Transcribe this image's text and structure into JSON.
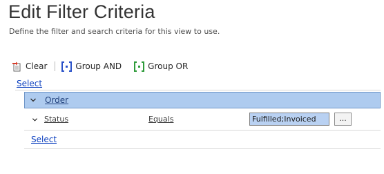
{
  "header": {
    "title": "Edit Filter Criteria",
    "subtitle": "Define the filter and search criteria for this view to use."
  },
  "toolbar": {
    "clear_label": "Clear",
    "group_and_label": "Group AND",
    "group_or_label": "Group OR"
  },
  "filter": {
    "top_select_label": "Select",
    "group": {
      "label": "Order"
    },
    "condition": {
      "field": "Status",
      "operator": "Equals",
      "value": "Fulfilled;Invoiced",
      "lookup_label": "..."
    },
    "bottom_select_label": "Select"
  },
  "colors": {
    "link": "#0b3fbf",
    "group_bar_bg": "#aecbef",
    "group_bar_border": "#6d94c7",
    "value_bg": "#b9d1f2"
  }
}
